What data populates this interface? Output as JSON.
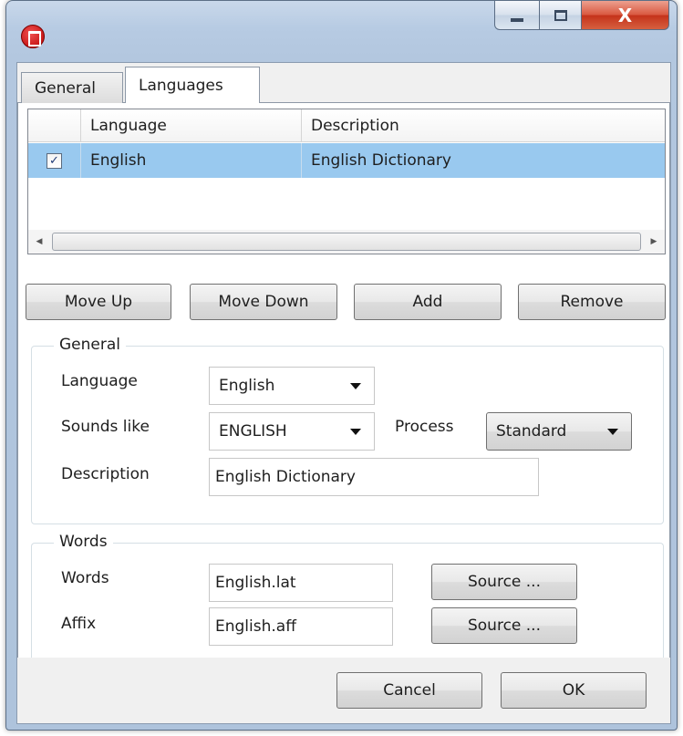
{
  "window": {
    "title": "",
    "caption_close": "X"
  },
  "tabs": [
    {
      "label": "General"
    },
    {
      "label": "Languages"
    }
  ],
  "grid": {
    "headers": [
      "Language",
      "Description"
    ],
    "rows": [
      {
        "checked": true,
        "language": "English",
        "description": "English Dictionary"
      }
    ]
  },
  "list_buttons": {
    "move_up": "Move Up",
    "move_down": "Move Down",
    "add": "Add",
    "remove": "Remove"
  },
  "general_group": {
    "legend": "General",
    "language_label": "Language",
    "language_value": "English",
    "sounds_like_label": "Sounds like",
    "sounds_like_value": "ENGLISH",
    "process_label": "Process",
    "process_value": "Standard",
    "description_label": "Description",
    "description_value": "English Dictionary"
  },
  "words_group": {
    "legend": "Words",
    "words_label": "Words",
    "words_value": "English.lat",
    "affix_label": "Affix",
    "affix_value": "English.aff",
    "source_label": "Source ..."
  },
  "dialog_buttons": {
    "cancel": "Cancel",
    "ok": "OK"
  },
  "colors": {
    "selection": "#99c9ef",
    "close_button": "#c4321a",
    "app_icon": "#b80000"
  }
}
